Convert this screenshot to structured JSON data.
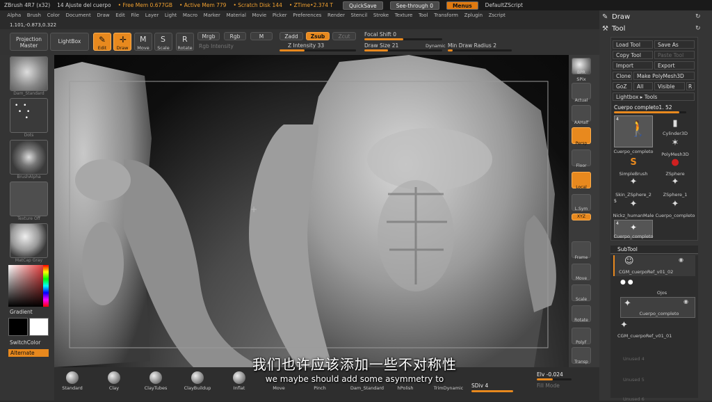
{
  "titlebar": {
    "app": "ZBrush 4R7 (x32)",
    "doc": "14 Ajuste del cuerpo",
    "free_mem": "• Free Mem 0.677GB",
    "active_mem": "• Active Mem 779",
    "scratch": "• Scratch Disk 144",
    "ztime": "• ZTime•2.374 T",
    "quicksave": "QuickSave",
    "seethrough": "See-through 0",
    "menus": "Menus",
    "script": "DefaultZScript"
  },
  "menubar": [
    "Alpha",
    "Brush",
    "Color",
    "Document",
    "Draw",
    "Edit",
    "File",
    "Layer",
    "Light",
    "Macro",
    "Marker",
    "Material",
    "Movie",
    "Picker",
    "Preferences",
    "Render",
    "Stencil",
    "Stroke",
    "Texture",
    "Tool",
    "Transform",
    "Zplugin",
    "Zscript"
  ],
  "coords": "1.101,-0.873,0.322",
  "toolbar": {
    "projection_master": "Projection Master",
    "lightbox": "LightBox",
    "edit": "Edit",
    "draw": "Draw",
    "move": "Move",
    "scale": "Scale",
    "rotate": "Rotate",
    "mrgb": "Mrgb",
    "rgb": "Rgb",
    "m": "M",
    "zadd": "Zadd",
    "zsub": "Zsub",
    "zcut": "Zcut",
    "rgb_intensity": "Rgb Intensity",
    "z_intensity": "Z Intensity 33",
    "z_intensity_value": 33,
    "focal_shift": "Focal Shift 0",
    "draw_size": "Draw Size 21",
    "dynamic": "Dynamic",
    "min_draw_radius": "Min Draw Radius 2"
  },
  "leftpanel": {
    "brush_caption": "Dam_Standard",
    "stroke_caption": "Dots",
    "alpha_caption": "BrushAlpha",
    "texture_caption": "Texture Off",
    "material_caption": "MatCap Gray",
    "gradient": "Gradient",
    "switchcolor": "SwitchColor",
    "alternate": "Alternate"
  },
  "rightstrip": [
    "BPR",
    "SPix",
    "Actual",
    "AAHalf",
    "Persp",
    "Floor",
    "Local",
    "L.Sym",
    "XYZ",
    "Frame",
    "Move",
    "Scale",
    "Rotate",
    "PolyF",
    "Transp"
  ],
  "tray": {
    "draw_title": "Draw",
    "tool_title": "Tool",
    "load_tool": "Load Tool",
    "save_as": "Save As",
    "copy_tool": "Copy Tool",
    "paste_tool": "Paste Tool",
    "import": "Import",
    "export": "Export",
    "clone": "Clone",
    "make_polymesh": "Make PolyMesh3D",
    "goz": "GoZ",
    "all": "All",
    "visible": "Visible",
    "r": "R",
    "lightbox_tools": "Lightbox ▸ Tools",
    "current_tool": "Cuerpo completo1. 52",
    "tools": [
      {
        "label": "Cuerpo_completo",
        "count": "4"
      },
      {
        "label": "Cylinder3D",
        "count": ""
      },
      {
        "label": "PolyMesh3D",
        "count": ""
      },
      {
        "label": "SimpleBrush",
        "count": ""
      },
      {
        "label": "ZSphere",
        "count": ""
      },
      {
        "label": "Skin_ZSphere_2",
        "count": ""
      },
      {
        "label": "ZSphere_1",
        "count": ""
      },
      {
        "label": "Nickz_humanMale",
        "count": "5"
      },
      {
        "label": "Cuerpo_completo",
        "count": ""
      },
      {
        "label": "Cuerpo_completo",
        "count": "4"
      }
    ],
    "subtool_title": "SubTool",
    "subtools": [
      "CGM_cuerpoRef_v01_02",
      "Ojos",
      "Cuerpo_completo",
      "CGM_cuerpoRef_v01_01",
      "Unused 4",
      "Unused 5",
      "Unused 6"
    ]
  },
  "bottombar": {
    "brushes": [
      "Standard",
      "Clay",
      "ClayTubes",
      "ClayBuildup",
      "Inflat",
      "Move",
      "Pinch",
      "Dam_Standard",
      "hPolish",
      "TrimDynamic"
    ],
    "sdiv": "SDiv 4",
    "elv": "Elv -0.024",
    "fill_mode": "Fill Mode"
  },
  "subtitle": {
    "zh": "我们也许应该添加一些不对称性",
    "en": "we maybe should add some asymmetry to"
  }
}
